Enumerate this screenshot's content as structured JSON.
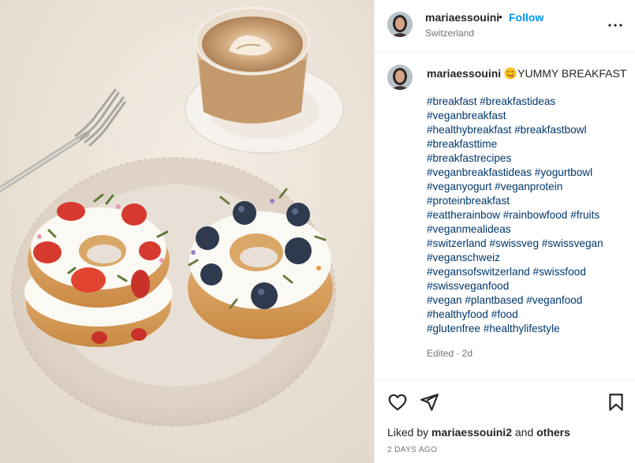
{
  "post": {
    "image_alt": "Breakfast bagels topped with yogurt, strawberries and blueberries beside a latte",
    "photo_colors": {
      "table": "#ece4d9",
      "plate": "#ddd2c4",
      "bagel": "#d9a05d",
      "cream": "#fbf9f3",
      "strawberry": "#d63a2f",
      "blueberry": "#2f3a4f",
      "coffee": "#b98c61"
    }
  },
  "header": {
    "username": "mariaessouini",
    "separator": "•",
    "follow_label": "Follow",
    "location": "Switzerland",
    "more_icon": "more-horizontal-icon"
  },
  "caption": {
    "username": "mariaessouini",
    "emoji": "face-savoring-food-emoji",
    "text": "YUMMY BREAKFAST",
    "hashtag_lines": [
      "#breakfast #breakfastideas",
      "#veganbreakfast",
      "#healthybreakfast #breakfastbowl",
      "#breakfasttime",
      "#breakfastrecipes",
      "#veganbreakfastideas #yogurtbowl",
      "#veganyogurt #veganprotein",
      "#proteinbreakfast",
      "#eattherainbow #rainbowfood #fruits",
      "#veganmealideas",
      "#switzerland #swissveg #swissvegan",
      "#veganschweiz",
      "#vegansofswitzerland #swissfood",
      "#swissveganfood",
      "#vegan #plantbased #veganfood",
      "#healthyfood #food",
      "#glutenfree #healthylifestyle"
    ],
    "edited": "Edited · 2d"
  },
  "actions": {
    "like_icon": "heart-icon",
    "share_icon": "paper-plane-icon",
    "save_icon": "bookmark-icon"
  },
  "likes": {
    "prefix": "Liked by",
    "user": "mariaessouini2",
    "connector": "and",
    "others": "others"
  },
  "timestamp": "2 DAYS AGO",
  "colors": {
    "link": "#0095f6",
    "hashtag": "#00376b",
    "text": "#262626",
    "muted": "#737373",
    "border": "#efefef"
  }
}
